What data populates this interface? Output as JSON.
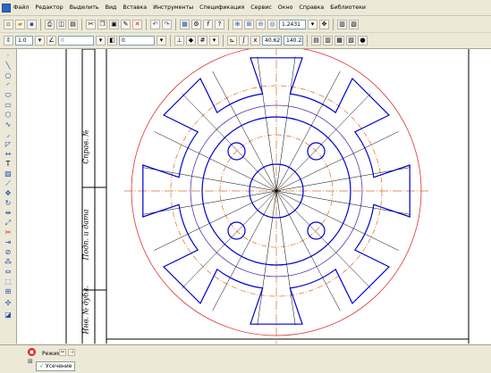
{
  "menu": {
    "items": [
      "Файл",
      "Редактор",
      "Выделить",
      "Вид",
      "Вставка",
      "Инструменты",
      "Спецификация",
      "Сервис",
      "Окно",
      "Справка",
      "Библиотеки"
    ]
  },
  "toolbar": {
    "zoom_value": "1.2431",
    "line_scale_value": "1.0",
    "angle_value": "0",
    "layer_value": "0",
    "coord_x": "40.627",
    "coord_y": "140.221"
  },
  "drawing": {
    "title_block_labels": [
      "Инв. № дубл.",
      "Подп. и дата",
      "Справ. №"
    ]
  },
  "properties": {
    "mode_label": "Режим",
    "tab_label": "Усечение"
  },
  "colors": {
    "outline": "#0000cc",
    "outer_circle": "#e03030",
    "center_lines": "#d8702a",
    "construction": "#000000",
    "pitch_circle": "#5d33aa"
  }
}
